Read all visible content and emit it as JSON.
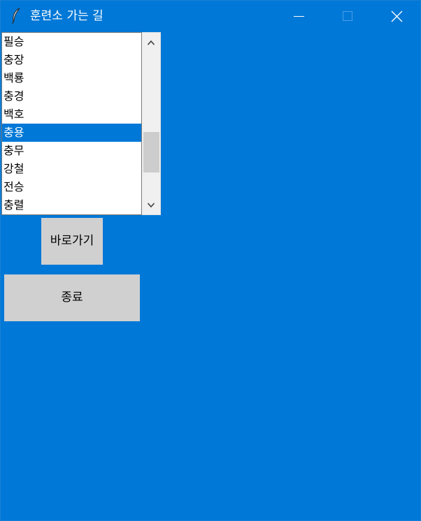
{
  "window": {
    "title": "훈련소 가는 길",
    "icon": "feather-icon",
    "controls": [
      "minimize-icon",
      "maximize-icon",
      "close-icon"
    ]
  },
  "listbox": {
    "items": [
      "필승",
      "충장",
      "백룡",
      "충경",
      "백호",
      "충용",
      "충무",
      "강철",
      "전승",
      "충렬"
    ],
    "selected": "충용"
  },
  "buttons": {
    "goto_label": "바로가기",
    "exit_label": "종료"
  },
  "colors": {
    "background": "#0078d7",
    "selection": "#0078d7",
    "button_face": "#d0d0d0",
    "scroll_thumb": "#cdcdcd"
  }
}
